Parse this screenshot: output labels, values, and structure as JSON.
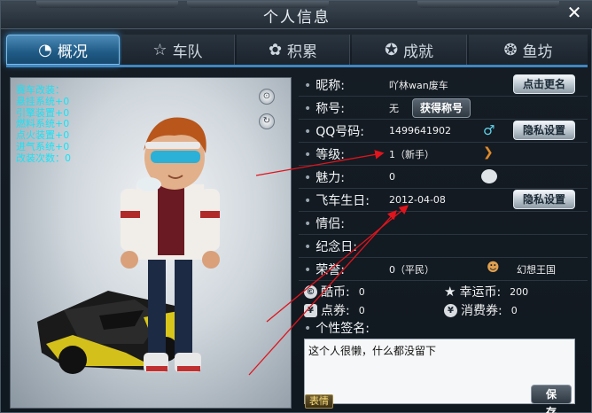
{
  "window": {
    "title": "个人信息",
    "close_label": "✕"
  },
  "tabs": [
    {
      "label": "概况",
      "icon": "overview-icon",
      "active": true
    },
    {
      "label": "车队",
      "icon": "star-icon",
      "active": false
    },
    {
      "label": "积累",
      "icon": "gear-icon",
      "active": false
    },
    {
      "label": "成就",
      "icon": "medal-icon",
      "active": false
    },
    {
      "label": "鱼坊",
      "icon": "fish-icon",
      "active": false
    }
  ],
  "avatar_panel": {
    "stats": [
      "赛车改装：",
      "悬挂系统+0",
      "引擎装置+0",
      "燃料系统+0",
      "点火装置+0",
      "进气系统+0",
      "改装次数：0"
    ]
  },
  "profile": {
    "nickname_label": "昵称:",
    "nickname_value": "吖林wan废车",
    "rename_button": "点击更名",
    "title_label": "称号:",
    "title_value": "无",
    "get_title_button": "获得称号",
    "qq_label": "QQ号码:",
    "qq_value": "1499641902",
    "privacy_button_1": "隐私设置",
    "level_label": "等级:",
    "level_value": "1（新手）",
    "charm_label": "魅力:",
    "charm_value": "0",
    "birthday_label": "飞车生日:",
    "birthday_value": "2012-04-08",
    "privacy_button_2": "隐私设置",
    "partner_label": "情侣:",
    "anniversary_label": "纪念日:",
    "honor_label": "荣誉:",
    "honor_value": "0（平民）",
    "kingdom_value": "幻想王国",
    "cool_coins_label": "酷币:",
    "cool_coins_value": "0",
    "lucky_coins_label": "幸运币:",
    "lucky_coins_value": "200",
    "vouchers_label": "点券:",
    "vouchers_value": "0",
    "spend_vouchers_label": "消费券:",
    "spend_vouchers_value": "0",
    "signature_label": "个性签名:",
    "signature_text": "这个人很懒，什么都没留下",
    "emoji_button": "表情",
    "save_button": "保 存"
  },
  "colors": {
    "accent": "#3f86c0",
    "stats_text": "#16e3f6",
    "annotation_arrow": "#e0141c"
  }
}
